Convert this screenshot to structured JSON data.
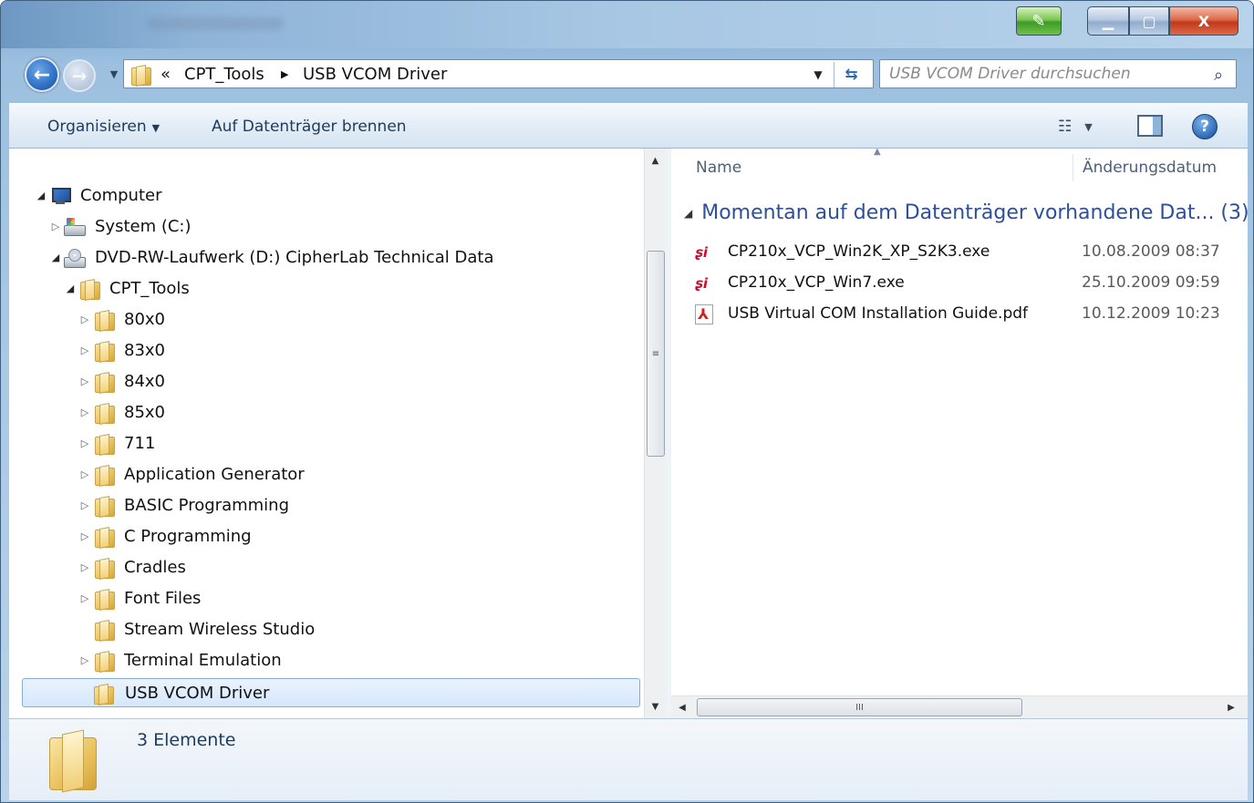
{
  "window": {
    "controls": {
      "minimize": "▁",
      "maximize": "▢",
      "close": "X"
    }
  },
  "nav": {
    "back_icon": "arrow-left-icon",
    "forward_icon": "arrow-right-icon",
    "address_prefix": "«",
    "breadcrumbs": [
      "CPT_Tools",
      "USB VCOM Driver"
    ],
    "breadcrumb_separator": "▶",
    "search_placeholder": "USB VCOM Driver durchsuchen"
  },
  "toolbar": {
    "organize_label": "Organisieren",
    "burn_label": "Auf Datenträger brennen"
  },
  "tree": {
    "items": [
      {
        "label": "Computer"
      },
      {
        "label": "System (C:)"
      },
      {
        "label": "DVD-RW-Laufwerk (D:) CipherLab Technical Data"
      },
      {
        "label": "CPT_Tools"
      },
      {
        "label": "80x0"
      },
      {
        "label": "83x0"
      },
      {
        "label": "84x0"
      },
      {
        "label": "85x0"
      },
      {
        "label": "711"
      },
      {
        "label": "Application Generator"
      },
      {
        "label": "BASIC Programming"
      },
      {
        "label": "C Programming"
      },
      {
        "label": "Cradles"
      },
      {
        "label": "Font Files"
      },
      {
        "label": "Stream Wireless Studio"
      },
      {
        "label": "Terminal Emulation"
      },
      {
        "label": "USB VCOM Driver"
      }
    ],
    "selected": "USB VCOM Driver"
  },
  "list": {
    "columns": {
      "name": "Name",
      "date": "Änderungsdatum"
    },
    "group": {
      "title": "Momentan auf dem Datenträger vorhandene Dat... (3)"
    },
    "files": [
      {
        "name": "CP210x_VCP_Win2K_XP_S2K3.exe",
        "date": "10.08.2009 08:37",
        "type": "exe"
      },
      {
        "name": "CP210x_VCP_Win7.exe",
        "date": "25.10.2009 09:59",
        "type": "exe"
      },
      {
        "name": "USB Virtual COM Installation Guide.pdf",
        "date": "10.12.2009 10:23",
        "type": "pdf"
      }
    ]
  },
  "details": {
    "item_count": "3 Elemente"
  },
  "scroll": {
    "grip": "≡",
    "hgrip": "III"
  }
}
